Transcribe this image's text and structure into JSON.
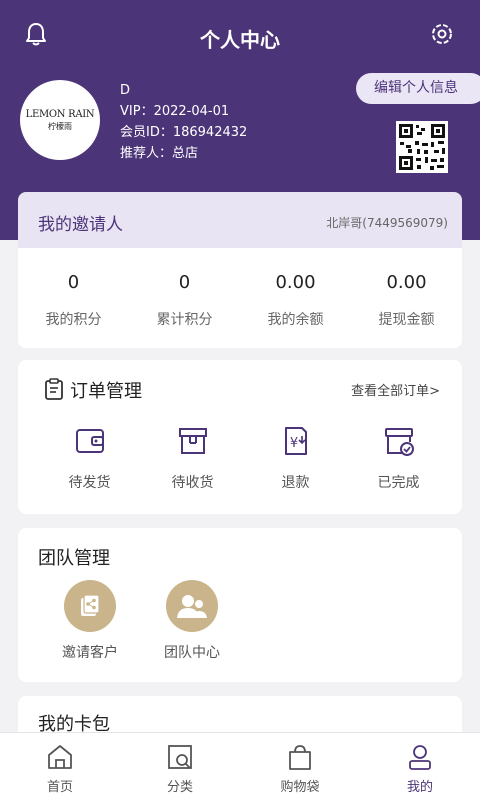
{
  "header": {
    "title": "个人中心",
    "bell_icon": "bell-icon",
    "settings_icon": "gear-icon",
    "bg_color": "#4c3479"
  },
  "profile": {
    "logo_line1": "LEMON RAIN",
    "logo_line2": "柠檬雨",
    "name": "D",
    "vip": "VIP：2022-04-01",
    "member_id": "会员ID：186942432",
    "referrer": "推荐人：总店",
    "edit_label": "编辑个人信息"
  },
  "inviter": {
    "label": "我的邀请人",
    "value": "北岸哥(7449569079)"
  },
  "stats": [
    {
      "value": "0",
      "label": "我的积分"
    },
    {
      "value": "0",
      "label": "累计积分"
    },
    {
      "value": "0.00",
      "label": "我的余额"
    },
    {
      "value": "0.00",
      "label": "提现金额"
    }
  ],
  "orders": {
    "title": "订单管理",
    "view_all": "查看全部订单>",
    "items": [
      {
        "label": "待发货",
        "icon": "wallet-icon"
      },
      {
        "label": "待收货",
        "icon": "box-icon"
      },
      {
        "label": "退款",
        "icon": "refund-icon"
      },
      {
        "label": "已完成",
        "icon": "completed-icon"
      }
    ]
  },
  "team": {
    "title": "团队管理",
    "items": [
      {
        "label": "邀请客户",
        "icon": "share-icon"
      },
      {
        "label": "团队中心",
        "icon": "team-icon"
      }
    ]
  },
  "wallet": {
    "title": "我的卡包"
  },
  "tabbar": [
    {
      "label": "首页",
      "icon": "home-icon"
    },
    {
      "label": "分类",
      "icon": "category-search-icon"
    },
    {
      "label": "购物袋",
      "icon": "bag-icon"
    },
    {
      "label": "我的",
      "icon": "person-icon",
      "active": true
    }
  ]
}
